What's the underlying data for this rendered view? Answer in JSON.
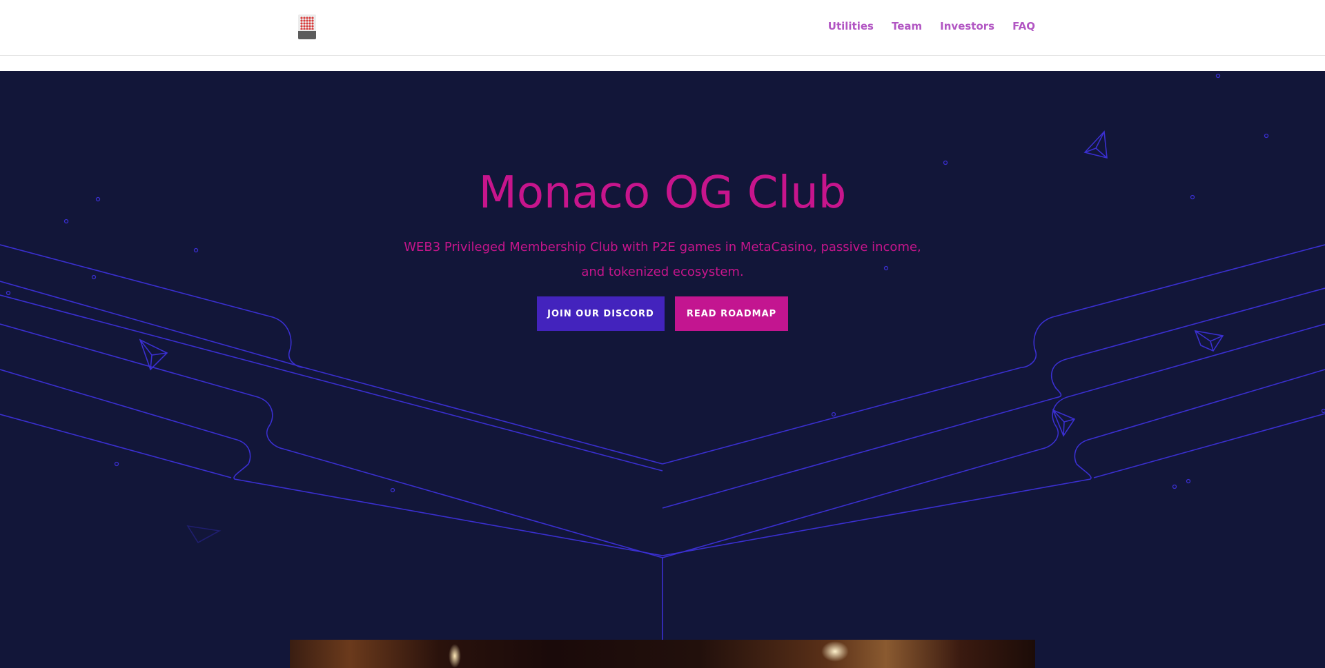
{
  "header": {
    "logo_name": "club-logo",
    "nav": [
      "Utilities",
      "Team",
      "Investors",
      "FAQ"
    ]
  },
  "hero": {
    "title": "Monaco OG Club",
    "subtitle": "WEB3 Privileged Membership Club with P2E games in MetaCasino, passive income, and tokenized ecosystem.",
    "buttons": {
      "discord": "JOIN OUR DISCORD",
      "roadmap": "READ ROADMAP"
    }
  },
  "colors": {
    "hero_background": "#121639",
    "accent_pink": "#c7158c",
    "button_purple": "#4323bd",
    "button_pink": "#c31590",
    "nav_link": "#b256c3",
    "line_blue": "#3a2fd0"
  }
}
